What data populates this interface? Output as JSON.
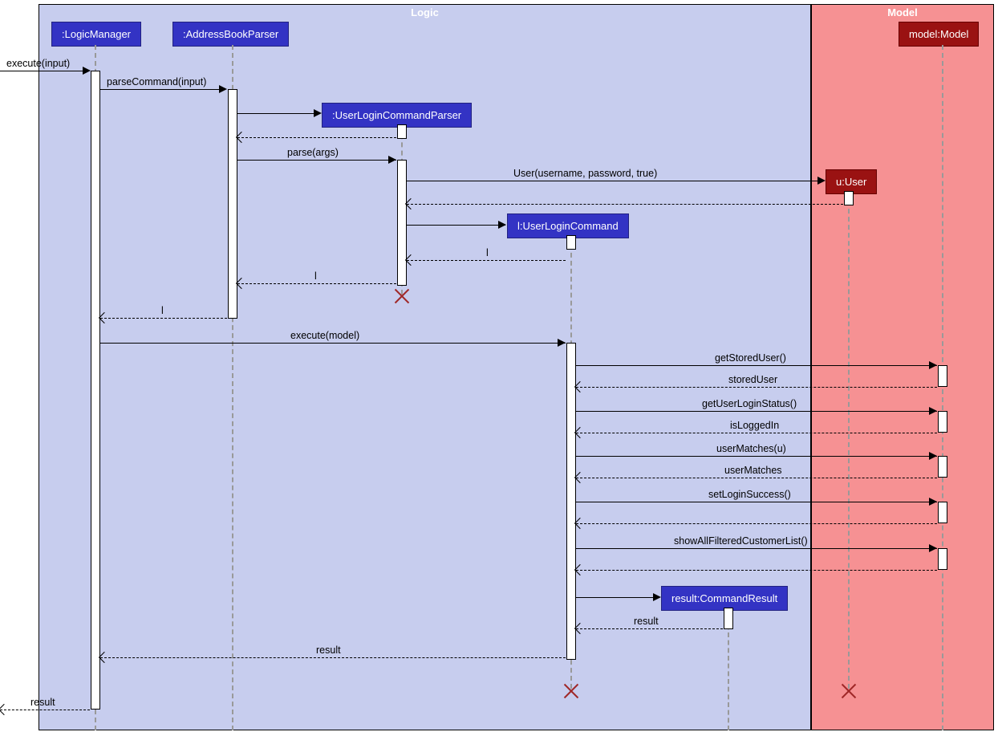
{
  "containers": {
    "logic": {
      "label": "Logic"
    },
    "model": {
      "label": "Model"
    }
  },
  "participants": {
    "logicManager": ":LogicManager",
    "addressBookParser": ":AddressBookParser",
    "userLoginCommandParser": ":UserLoginCommandParser",
    "userLoginCommand": "l:UserLoginCommand",
    "commandResult": "result:CommandResult",
    "user": "u:User",
    "model": "model:Model"
  },
  "messages": {
    "executeInput": "execute(input)",
    "parseCommand": "parseCommand(input)",
    "parseArgs": "parse(args)",
    "userCtor": "User(username, password, true)",
    "returnL1": "l",
    "returnL2": "l",
    "executeModel": "execute(model)",
    "getStoredUser": "getStoredUser()",
    "storedUser": "storedUser",
    "getUserLoginStatus": "getUserLoginStatus()",
    "isLoggedIn": "isLoggedIn",
    "userMatches": "userMatches(u)",
    "userMatchesRet": "userMatches",
    "setLoginSuccess": "setLoginSuccess()",
    "showAllFiltered": "showAllFilteredCustomerList()",
    "resultRet1": "result",
    "resultRet2": "result",
    "resultRet3": "result"
  }
}
